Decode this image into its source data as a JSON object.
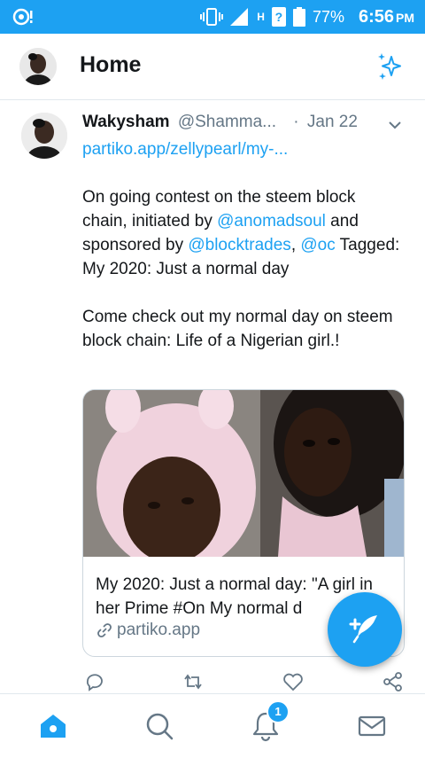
{
  "status_bar": {
    "battery_percent": "77%",
    "time": "6:56",
    "ampm": "PM",
    "network": "H",
    "sim_badge": "?"
  },
  "header": {
    "title": "Home"
  },
  "tweet": {
    "author_name": "Wakysham",
    "author_handle": "@Shamma...",
    "separator": "·",
    "date": "Jan 22",
    "link_text": "partiko.app/zellypearl/my-...",
    "p2_part1": "On going contest on the steem block chain, initiated by ",
    "mention1": "@anomadsoul",
    "p2_part2": " and sponsored by ",
    "mention2": "@blocktrades",
    "comma": ", ",
    "mention3": "@oc",
    "p2_part3": " Tagged: My 2020: Just a normal day",
    "p3": "Come check out my normal day on steem block chain: Life of a Nigerian girl.!",
    "card": {
      "title": "My 2020: Just a normal day: \"A girl in her Prime #On My normal d",
      "domain": "partiko.app"
    }
  },
  "bottom_nav": {
    "notifications_count": "1"
  },
  "colors": {
    "brand_blue": "#1da1f2",
    "secondary_gray": "#657786",
    "border": "#e1e8ed"
  },
  "icons": [
    "home-icon",
    "search-icon",
    "bell-icon",
    "mail-icon",
    "sparkle-icon",
    "compose-icon",
    "reply-icon",
    "retweet-icon",
    "like-icon",
    "share-icon",
    "chevron-down-icon",
    "link-icon"
  ]
}
